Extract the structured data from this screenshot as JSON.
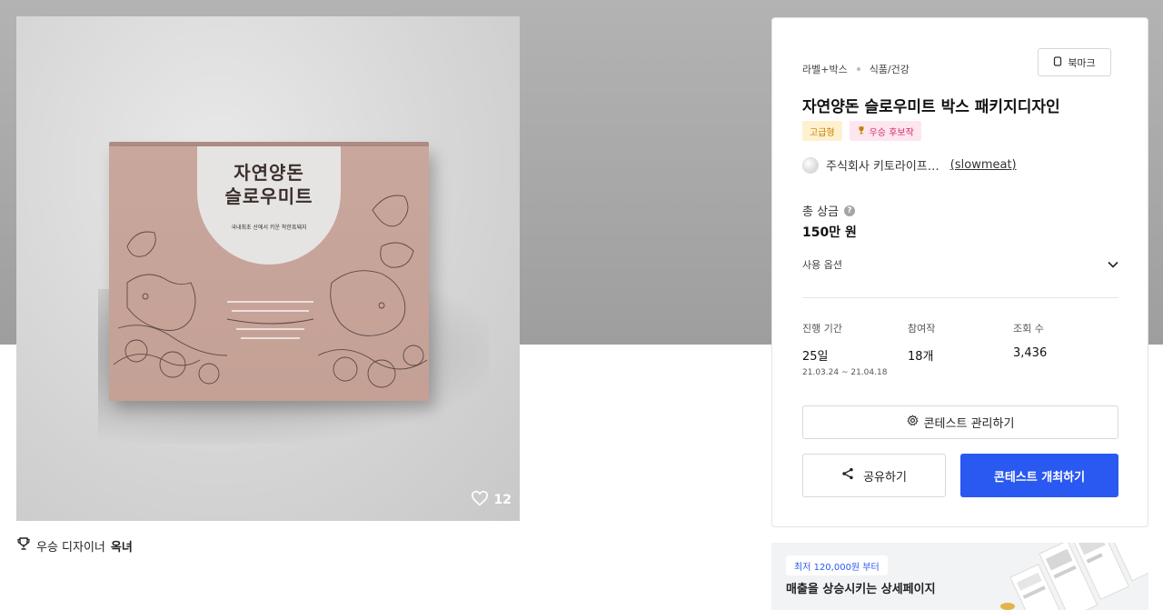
{
  "product": {
    "box_title": "자연양돈\n슬로우미트",
    "box_subtitle": "국내최초 산에서 키운 착한흑돼지",
    "like_count": "12",
    "like_icon": "heart-outline-icon"
  },
  "designer": {
    "label": "우승 디자이너",
    "name": "옥녀",
    "icon": "trophy-icon"
  },
  "card": {
    "category_1": "라벨+박스",
    "category_2": "식품/건강",
    "bookmark_label": "북마크",
    "title": "자연양돈 슬로우미트 박스 패키지디자인",
    "badges": {
      "premium": "고급형",
      "winner": "우승 후보작"
    },
    "company_name": "주식회사 키토라이프…",
    "company_handle": "(slowmeat)",
    "prize_label": "총 상금",
    "prize_help": "?",
    "prize_value": "150만 원",
    "usage_label": "사용 옵션",
    "stats": {
      "duration_label": "진행 기간",
      "duration_value": "25일",
      "duration_range": "21.03.24 ~ 21.04.18",
      "participants_label": "참여작",
      "participants_value": "18개",
      "views_label": "조회 수",
      "views_value": "3,436"
    },
    "manage_label": "콘테스트 관리하기",
    "share_label": "공유하기",
    "host_label": "콘테스트 개최하기"
  },
  "ad": {
    "pill": "최저 120,000원 부터",
    "text": "매출을 상승시키는 상세페이지"
  },
  "colors": {
    "primary": "#2a59f1",
    "premium_bg": "#fff1cf",
    "premium_text": "#c47f00",
    "winner_bg": "#fde6ef",
    "winner_text": "#d62d6c"
  }
}
